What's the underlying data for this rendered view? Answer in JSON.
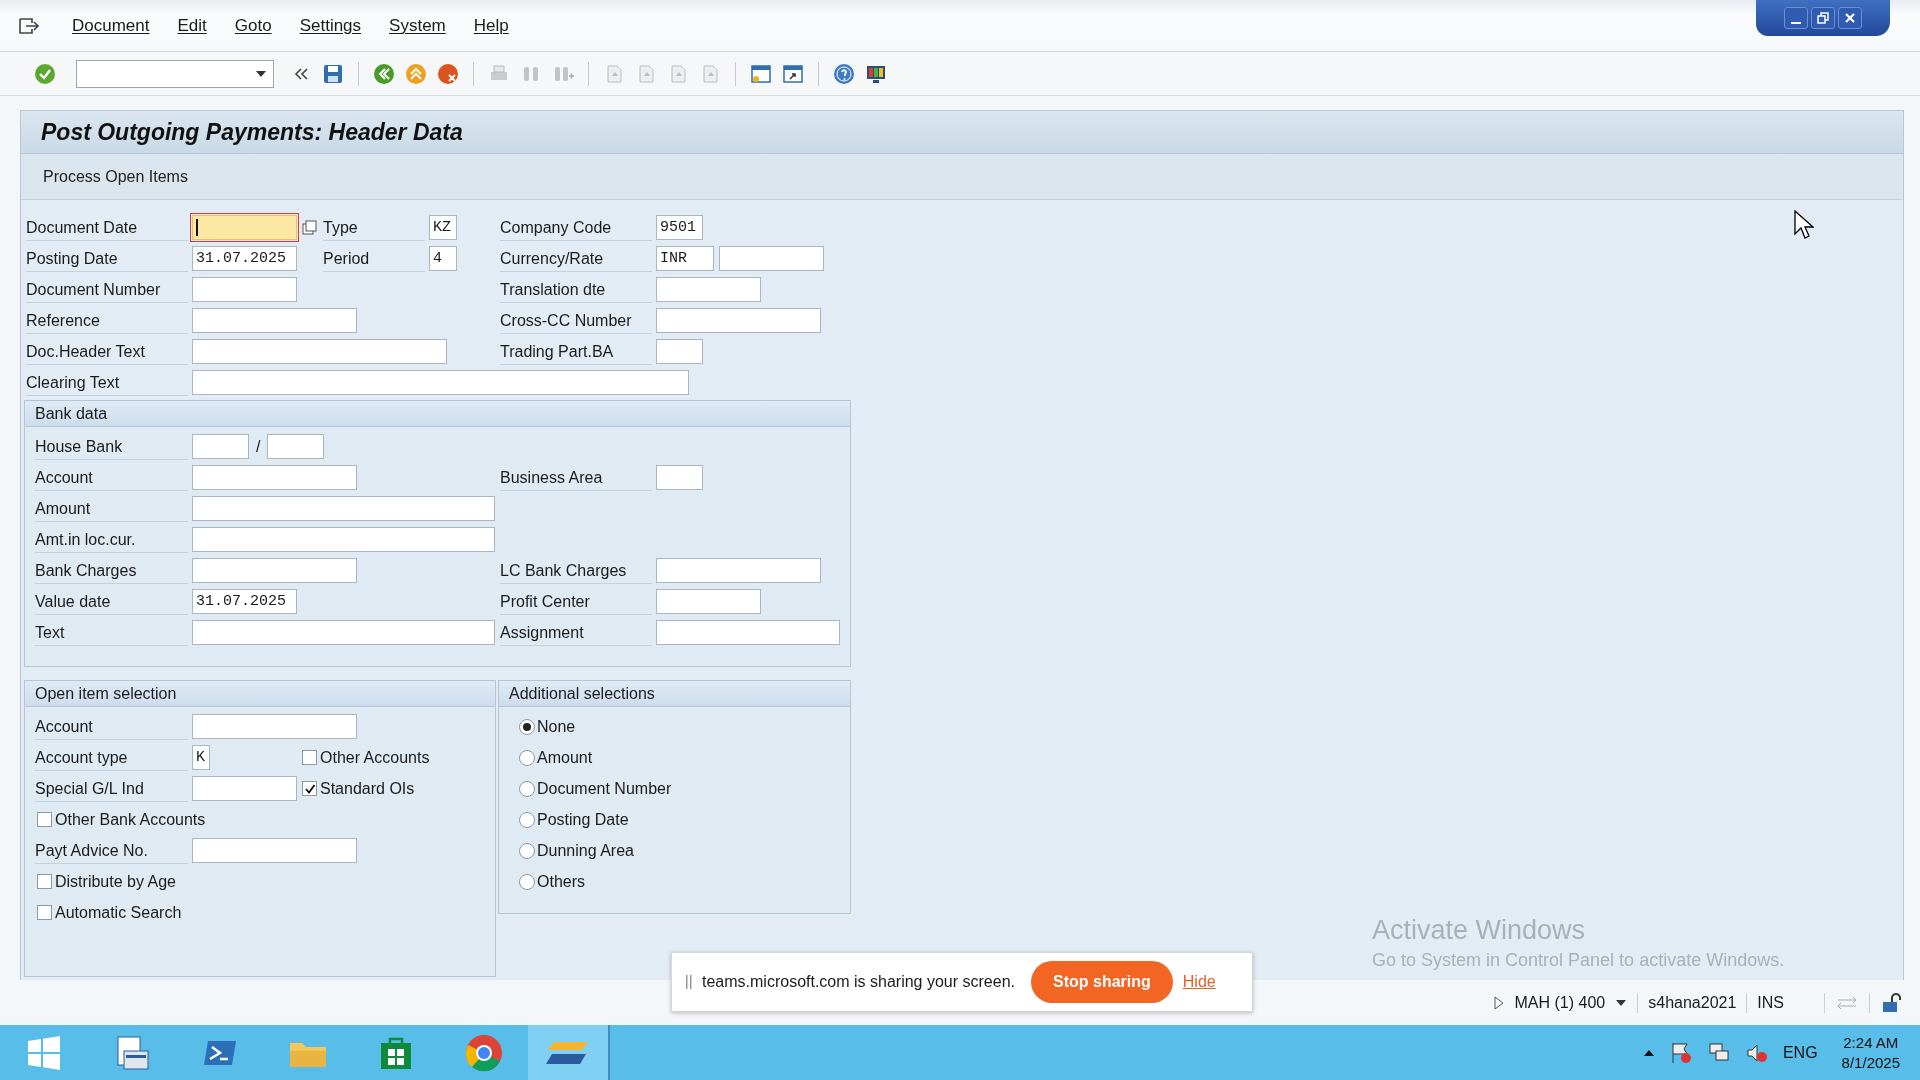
{
  "menu": [
    "Document",
    "Edit",
    "Goto",
    "Settings",
    "System",
    "Help"
  ],
  "title": "Post Outgoing Payments: Header Data",
  "app_toolbar": [
    "Process Open Items"
  ],
  "header_rows": [
    {
      "left": {
        "label": "Document Date",
        "fields": [
          {
            "focused": true
          }
        ],
        "help_button": true
      },
      "middle": {
        "label": "Type",
        "fields": [
          {
            "value": "KZ",
            "focused": false
          }
        ]
      },
      "right": {
        "label": "Company Code",
        "fields": [
          {
            "value": "9501",
            "focused": false
          }
        ]
      }
    },
    {
      "left": {
        "label": "Posting Date",
        "fields": [
          {
            "value": "31.07.2025",
            "focused": false
          }
        ]
      },
      "middle": {
        "label": "Period",
        "fields": [
          {
            "value": "4",
            "focused": false
          }
        ]
      },
      "right": {
        "label": "Currency/Rate",
        "fields": [
          {
            "value": "INR",
            "focused": false
          },
          {
            "focused": false
          }
        ]
      }
    },
    {
      "left": {
        "label": "Document Number",
        "fields": [
          {
            "focused": false
          }
        ]
      },
      "right": {
        "label": "Translation dte",
        "fields": [
          {
            "focused": false
          }
        ]
      }
    },
    {
      "left": {
        "label": "Reference",
        "fields": [
          {
            "focused": false
          }
        ]
      },
      "right": {
        "label": "Cross-CC Number",
        "fields": [
          {
            "focused": false
          }
        ]
      }
    },
    {
      "left": {
        "label": "Doc.Header Text",
        "fields": [
          {
            "focused": false
          }
        ]
      },
      "right": {
        "label": "Trading Part.BA",
        "fields": [
          {
            "focused": false
          }
        ]
      }
    },
    {
      "left": {
        "label": "Clearing Text",
        "fields": [
          {
            "focused": false
          }
        ]
      }
    }
  ],
  "bank_data": {
    "title": "Bank data",
    "rows": [
      {
        "left": {
          "label": "House Bank",
          "fields": [
            {
              "focused": false
            },
            {
              "focused": false
            }
          ],
          "separator": "/"
        }
      },
      {
        "left": {
          "label": "Account",
          "fields": [
            {
              "focused": false
            }
          ]
        },
        "right": {
          "label": "Business Area",
          "fields": [
            {
              "focused": false
            }
          ]
        }
      },
      {
        "left": {
          "label": "Amount",
          "fields": [
            {
              "focused": false
            }
          ]
        }
      },
      {
        "left": {
          "label": "Amt.in loc.cur.",
          "fields": [
            {
              "focused": false
            }
          ]
        }
      },
      {
        "left": {
          "label": "Bank Charges",
          "fields": [
            {
              "focused": false
            }
          ]
        },
        "right": {
          "label": "LC Bank Charges",
          "fields": [
            {
              "focused": false
            }
          ]
        }
      },
      {
        "left": {
          "label": "Value date",
          "fields": [
            {
              "value": "31.07.2025",
              "focused": false
            }
          ]
        },
        "right": {
          "label": "Profit Center",
          "fields": [
            {
              "focused": false
            }
          ]
        }
      },
      {
        "left": {
          "label": "Text",
          "fields": [
            {
              "focused": false
            }
          ]
        },
        "right": {
          "label": "Assignment",
          "fields": [
            {
              "focused": false
            }
          ]
        }
      }
    ]
  },
  "open_item_selection": {
    "title": "Open item selection",
    "rows": [
      {
        "kind": "field",
        "label": "Account",
        "field": {
          "focused": false
        }
      },
      {
        "kind": "field",
        "label": "Account type",
        "field": {
          "value": "K",
          "focused": false
        },
        "checkbox": {
          "label": "Other Accounts",
          "checked": false
        }
      },
      {
        "kind": "field",
        "label": "Special G/L Ind",
        "field": {
          "focused": false
        },
        "checkbox": {
          "label": "Standard OIs",
          "checked": true
        }
      },
      {
        "kind": "checkbox",
        "checkbox": {
          "label": "Other Bank Accounts",
          "checked": false
        }
      },
      {
        "kind": "field",
        "label": "Payt Advice No.",
        "field": {
          "focused": false
        }
      },
      {
        "kind": "checkbox",
        "checkbox": {
          "label": "Distribute by Age",
          "checked": false
        }
      },
      {
        "kind": "checkbox",
        "checkbox": {
          "label": "Automatic Search",
          "checked": false
        }
      }
    ]
  },
  "additional_selections": {
    "title": "Additional selections",
    "options": [
      {
        "label": "None",
        "selected": true
      },
      {
        "label": "Amount",
        "selected": false
      },
      {
        "label": "Document Number",
        "selected": false
      },
      {
        "label": "Posting Date",
        "selected": false
      },
      {
        "label": "Dunning Area",
        "selected": false
      },
      {
        "label": "Others",
        "selected": false
      }
    ]
  },
  "activation_notice": {
    "title": "Activate Windows",
    "text": "Go to System in Control Panel to activate Windows."
  },
  "sharing_bar": {
    "text": "teams.microsoft.com is sharing your screen.",
    "stop_button": "Stop sharing",
    "hide_link": "Hide"
  },
  "status_bar": {
    "system": "MAH (1) 400",
    "server": "s4hana2021",
    "mode": "INS"
  },
  "taskbar": {
    "language": "ENG",
    "time": "2:24 AM",
    "date": "8/1/2025"
  }
}
